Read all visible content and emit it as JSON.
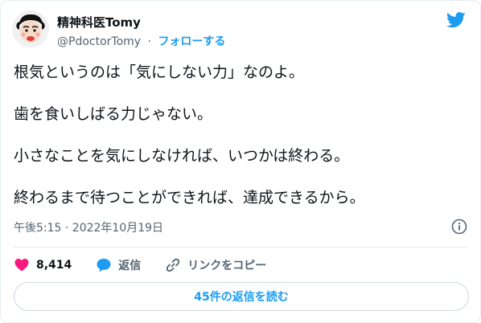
{
  "author": {
    "display_name": "精神科医Tomy",
    "handle": "@PdoctorTomy",
    "separator": "·",
    "follow_label": "フォローする"
  },
  "tweet": {
    "paragraphs": [
      "根気というのは「気にしない力」なのよ。",
      "歯を食いしばる力じゃない。",
      "小さなことを気にしなければ、いつかは終わる。",
      "終わるまで待つことができれば、達成できるから。"
    ],
    "timestamp": "午後5:15 · 2022年10月19日"
  },
  "actions": {
    "like_count": "8,414",
    "reply_label": "返信",
    "copy_link_label": "リンクをコピー"
  },
  "replies_button": {
    "label": "45件の返信を読む"
  },
  "colors": {
    "brand_blue": "#1d9bf0",
    "like_pink": "#f91880",
    "text_primary": "#0f1419",
    "text_secondary": "#536471"
  },
  "icons": [
    "twitter-bird-icon",
    "info-icon",
    "heart-icon",
    "reply-bubble-icon",
    "link-icon"
  ]
}
